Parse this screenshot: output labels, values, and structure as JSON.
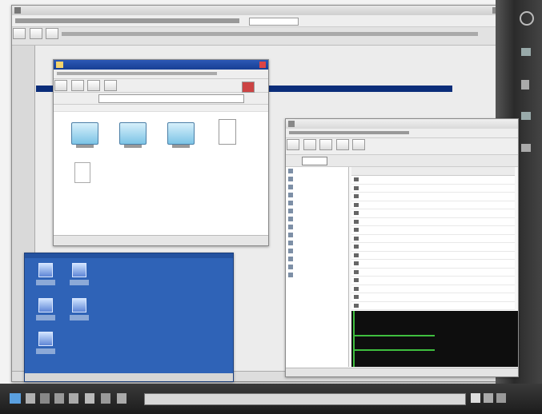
{
  "colors": {
    "titlebar": "#1f4aa0",
    "desktop_blue": "#2f63b7",
    "taskbar": "#2a2a2a",
    "dark_panel": "#0e0e0e",
    "graph_green": "#3fbf3f"
  },
  "icons": [
    "window-menu-icon",
    "maximize-icon",
    "close-icon",
    "folder-icon",
    "back-arrow-icon",
    "forward-arrow-icon",
    "up-arrow-icon",
    "search-icon",
    "document-icon",
    "computer-icon",
    "network-icon",
    "trash-icon",
    "start-icon",
    "terminal-icon",
    "settings-icon",
    "volume-icon",
    "network-tray-icon",
    "clock-icon"
  ],
  "browser": {
    "title": "",
    "address": "",
    "menu": []
  },
  "explorer": {
    "title": "",
    "address": "",
    "menu": [],
    "status": ""
  },
  "manager": {
    "title": "",
    "toolbar_button": "",
    "menu": []
  },
  "desktop_window": {
    "title": ""
  },
  "taskbar": {
    "task_label": ""
  }
}
